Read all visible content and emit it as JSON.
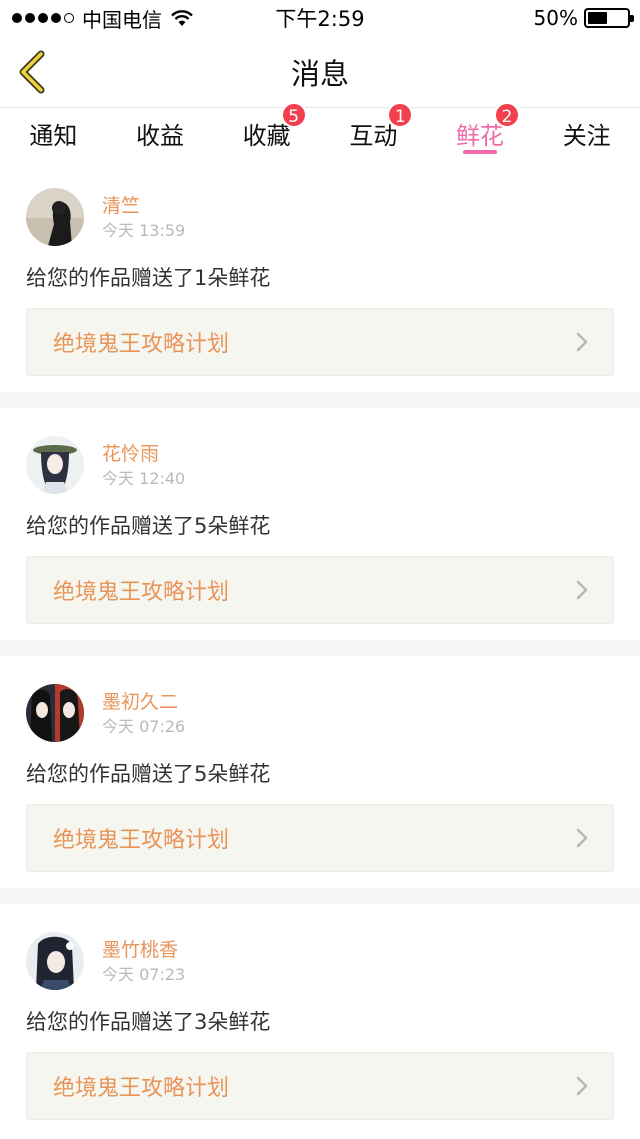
{
  "status_bar": {
    "carrier": "中国电信",
    "time": "下午2:59",
    "battery": "50%",
    "battery_level": 0.5
  },
  "nav": {
    "title": "消息"
  },
  "tabs": [
    {
      "label": "通知",
      "badge": null,
      "active": false
    },
    {
      "label": "收益",
      "badge": null,
      "active": false
    },
    {
      "label": "收藏",
      "badge": "5",
      "active": false
    },
    {
      "label": "互动",
      "badge": "1",
      "active": false
    },
    {
      "label": "鲜花",
      "badge": "2",
      "active": true
    },
    {
      "label": "关注",
      "badge": null,
      "active": false
    }
  ],
  "colors": {
    "accent_pink": "#f06aa8",
    "badge_red": "#f2404f",
    "name_orange": "#e8955a"
  },
  "messages": [
    {
      "user": "清竺",
      "time": "今天 13:59",
      "text": "给您的作品赠送了1朵鲜花",
      "work": "绝境鬼王攻略计划"
    },
    {
      "user": "花怜雨",
      "time": "今天 12:40",
      "text": "给您的作品赠送了5朵鲜花",
      "work": "绝境鬼王攻略计划"
    },
    {
      "user": "墨初久二",
      "time": "今天 07:26",
      "text": "给您的作品赠送了5朵鲜花",
      "work": "绝境鬼王攻略计划"
    },
    {
      "user": "墨竹桃香",
      "time": "今天 07:23",
      "text": "给您的作品赠送了3朵鲜花",
      "work": "绝境鬼王攻略计划"
    }
  ]
}
